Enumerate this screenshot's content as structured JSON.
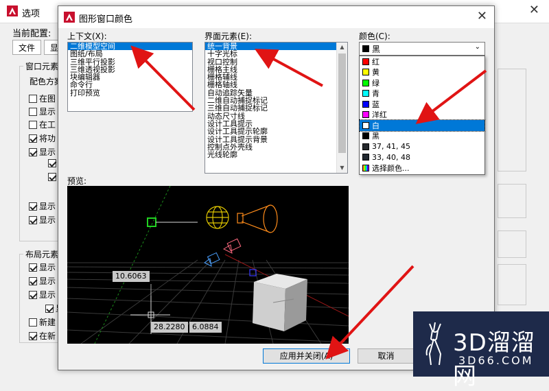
{
  "background": {
    "title": "选项",
    "current_config_label": "当前配置:",
    "tabs": [
      "文件",
      "显"
    ],
    "group1_label": "窗口元素",
    "group1_sub": "配色方案",
    "group1_checks": [
      {
        "label": "在图",
        "checked": false
      },
      {
        "label": "显示",
        "checked": false
      },
      {
        "label": "在工",
        "checked": false
      },
      {
        "label": "将功",
        "checked": true
      },
      {
        "label": "显示",
        "checked": true
      }
    ],
    "group1_subchecks": [
      {
        "checked": true
      },
      {
        "checked": true
      }
    ],
    "group1_checks2": [
      {
        "label": "显示",
        "checked": true
      },
      {
        "label": "显示",
        "checked": true
      }
    ],
    "group2_label": "布局元素",
    "group2_checks": [
      {
        "label": "显示",
        "checked": true
      },
      {
        "label": "显示",
        "checked": true
      },
      {
        "label": "显示",
        "checked": true
      }
    ],
    "group2_sub_check": {
      "label": "显",
      "checked": true
    },
    "group2_checks2": [
      {
        "label": "新建",
        "checked": false
      },
      {
        "label": "在新",
        "checked": true
      }
    ]
  },
  "dialog": {
    "title": "图形窗口颜色",
    "context_label": "上下文(X):",
    "context_items": [
      "二维模型空间",
      "图纸/布局",
      "三维平行投影",
      "三维透视投影",
      "块编辑器",
      "命令行",
      "打印预览"
    ],
    "context_selected": 0,
    "element_label": "界面元素(E):",
    "element_items": [
      "统一背景",
      "十字光标",
      "视口控制",
      "栅格主线",
      "栅格辅线",
      "栅格轴线",
      "自动追踪矢量",
      "二维自动捕捉标记",
      "三维自动捕捉标记",
      "动态尺寸线",
      "设计工具提示",
      "设计工具提示轮廓",
      "设计工具提示背景",
      "控制点外壳线",
      "光线轮廓"
    ],
    "element_selected": 0,
    "color_label": "颜色(C):",
    "color_value": "黑",
    "color_value_swatch": "#000000",
    "color_options": [
      {
        "label": "红",
        "swatch": "#ff0000"
      },
      {
        "label": "黄",
        "swatch": "#ffff00"
      },
      {
        "label": "绿",
        "swatch": "#00ff00"
      },
      {
        "label": "青",
        "swatch": "#00ffff"
      },
      {
        "label": "蓝",
        "swatch": "#0000ff"
      },
      {
        "label": "洋红",
        "swatch": "#ff00ff"
      },
      {
        "label": "白",
        "swatch": "#ffffff"
      },
      {
        "label": "黑",
        "swatch": "#000000"
      },
      {
        "label": "37, 41, 45",
        "swatch": "#25292d"
      },
      {
        "label": "33, 40, 48",
        "swatch": "#212830"
      },
      {
        "label": "选择颜色...",
        "swatch": "multicolor"
      }
    ],
    "color_option_selected": 6,
    "preview_label": "预览:",
    "preview_values": {
      "dim1": "10.6063",
      "dim2": "28.2280",
      "dim3": "6.0884"
    },
    "apply_label": "应用并关闭(A)",
    "cancel_label": "取消"
  },
  "watermark": {
    "text1": "3D溜溜网",
    "text2": "3D66.COM"
  },
  "colors": {
    "accent": "#0078d7",
    "arrow": "#e01414",
    "preview_bg": "#000000",
    "watermark_bg": "#1e2a4a"
  }
}
